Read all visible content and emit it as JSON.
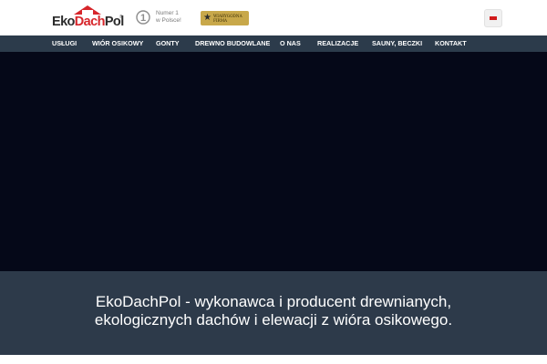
{
  "header": {
    "logo": {
      "part1": "Eko",
      "part2": "Dach",
      "part3": "Pol",
      "reg": "®"
    },
    "badge_numer1": {
      "text": "Numer 1\nw Polsce!"
    },
    "badge_firma": {
      "text": "WIARYGODNA\nFIRMA"
    },
    "language_flag": "polish-flag-icon"
  },
  "nav": {
    "items": [
      {
        "label": "USŁUGI"
      },
      {
        "label": "WIÓR OSIKOWY"
      },
      {
        "label": "GONTY"
      },
      {
        "label": "DREWNO BUDOWLANE"
      },
      {
        "label": "O NAS"
      },
      {
        "label": "REALIZACJE"
      },
      {
        "label": "SAUNY, BECZKI"
      },
      {
        "label": "KONTAKT"
      }
    ]
  },
  "tagline": {
    "line1": "EkoDachPol - wykonawca i producent drewnianych,",
    "line2": "ekologicznych dachów i elewacji z wióra osikowego."
  },
  "colors": {
    "nav_bg": "#2c3b4b",
    "hero_bg": "#050818",
    "tagline_bg": "#2d3a4a",
    "brand_red": "#d7262b",
    "badge_gold": "#c8a84a"
  }
}
